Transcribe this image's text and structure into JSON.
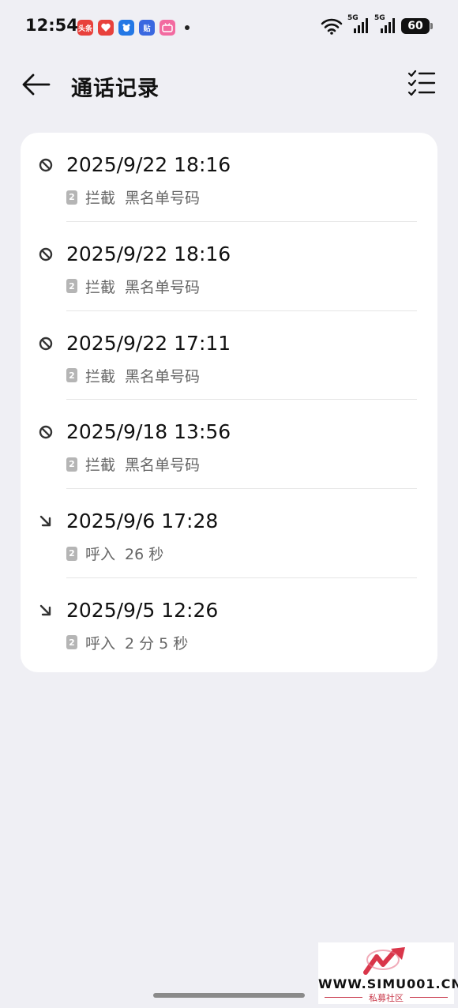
{
  "status_bar": {
    "time": "12:54",
    "apps": [
      {
        "icon": "toutiao-icon",
        "label": "头条",
        "color": "#e8413c"
      },
      {
        "icon": "heart-app-icon",
        "label": "",
        "color": "#e8413c"
      },
      {
        "icon": "baidu-bear-icon",
        "label": "",
        "color": "#2478e5"
      },
      {
        "icon": "tieba-icon",
        "label": "贴",
        "color": "#3a68e0"
      },
      {
        "icon": "bilibili-icon",
        "label": "",
        "color": "#f26aa0"
      }
    ],
    "network1": "5G",
    "network2": "5G",
    "battery": "60"
  },
  "header": {
    "title": "通话记录",
    "back_icon": "arrow-left-icon",
    "multiselect_icon": "checklist-icon"
  },
  "calls": [
    {
      "type": "blocked",
      "icon": "block-icon",
      "datetime": "2025/9/22 18:16",
      "sim": "2",
      "status": "拦截",
      "detail": "黑名单号码"
    },
    {
      "type": "blocked",
      "icon": "block-icon",
      "datetime": "2025/9/22 18:16",
      "sim": "2",
      "status": "拦截",
      "detail": "黑名单号码"
    },
    {
      "type": "blocked",
      "icon": "block-icon",
      "datetime": "2025/9/22 17:11",
      "sim": "2",
      "status": "拦截",
      "detail": "黑名单号码"
    },
    {
      "type": "blocked",
      "icon": "block-icon",
      "datetime": "2025/9/18 13:56",
      "sim": "2",
      "status": "拦截",
      "detail": "黑名单号码"
    },
    {
      "type": "incoming",
      "icon": "incoming-arrow-icon",
      "datetime": "2025/9/6 17:28",
      "sim": "2",
      "status": "呼入",
      "detail": "26 秒"
    },
    {
      "type": "incoming",
      "icon": "incoming-arrow-icon",
      "datetime": "2025/9/5 12:26",
      "sim": "2",
      "status": "呼入",
      "detail": "2 分 5 秒"
    }
  ],
  "watermark": {
    "site": "WWW.SIMU001.CN",
    "caption": "私募社区"
  }
}
